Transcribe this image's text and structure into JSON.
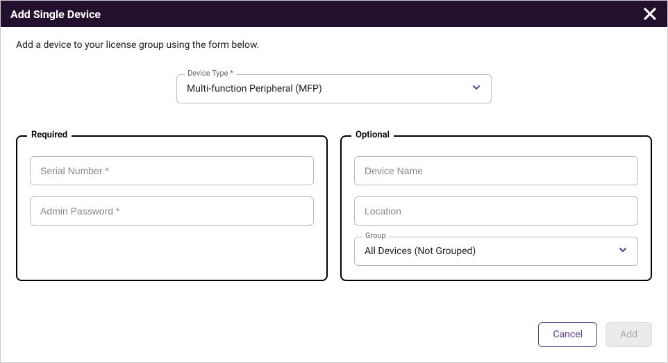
{
  "header": {
    "title": "Add Single Device"
  },
  "description": "Add a device to your license group using the form below.",
  "deviceType": {
    "label": "Device Type *",
    "value": "Multi-function Peripheral (MFP)"
  },
  "required": {
    "legend": "Required",
    "serial_placeholder": "Serial Number *",
    "serial_value": "",
    "admin_placeholder": "Admin Password *",
    "admin_value": ""
  },
  "optional": {
    "legend": "Optional",
    "devicename_placeholder": "Device Name",
    "devicename_value": "",
    "location_placeholder": "Location",
    "location_value": "",
    "group_label": "Group",
    "group_value": "All Devices (Not Grouped)"
  },
  "footer": {
    "cancel": "Cancel",
    "add": "Add"
  }
}
